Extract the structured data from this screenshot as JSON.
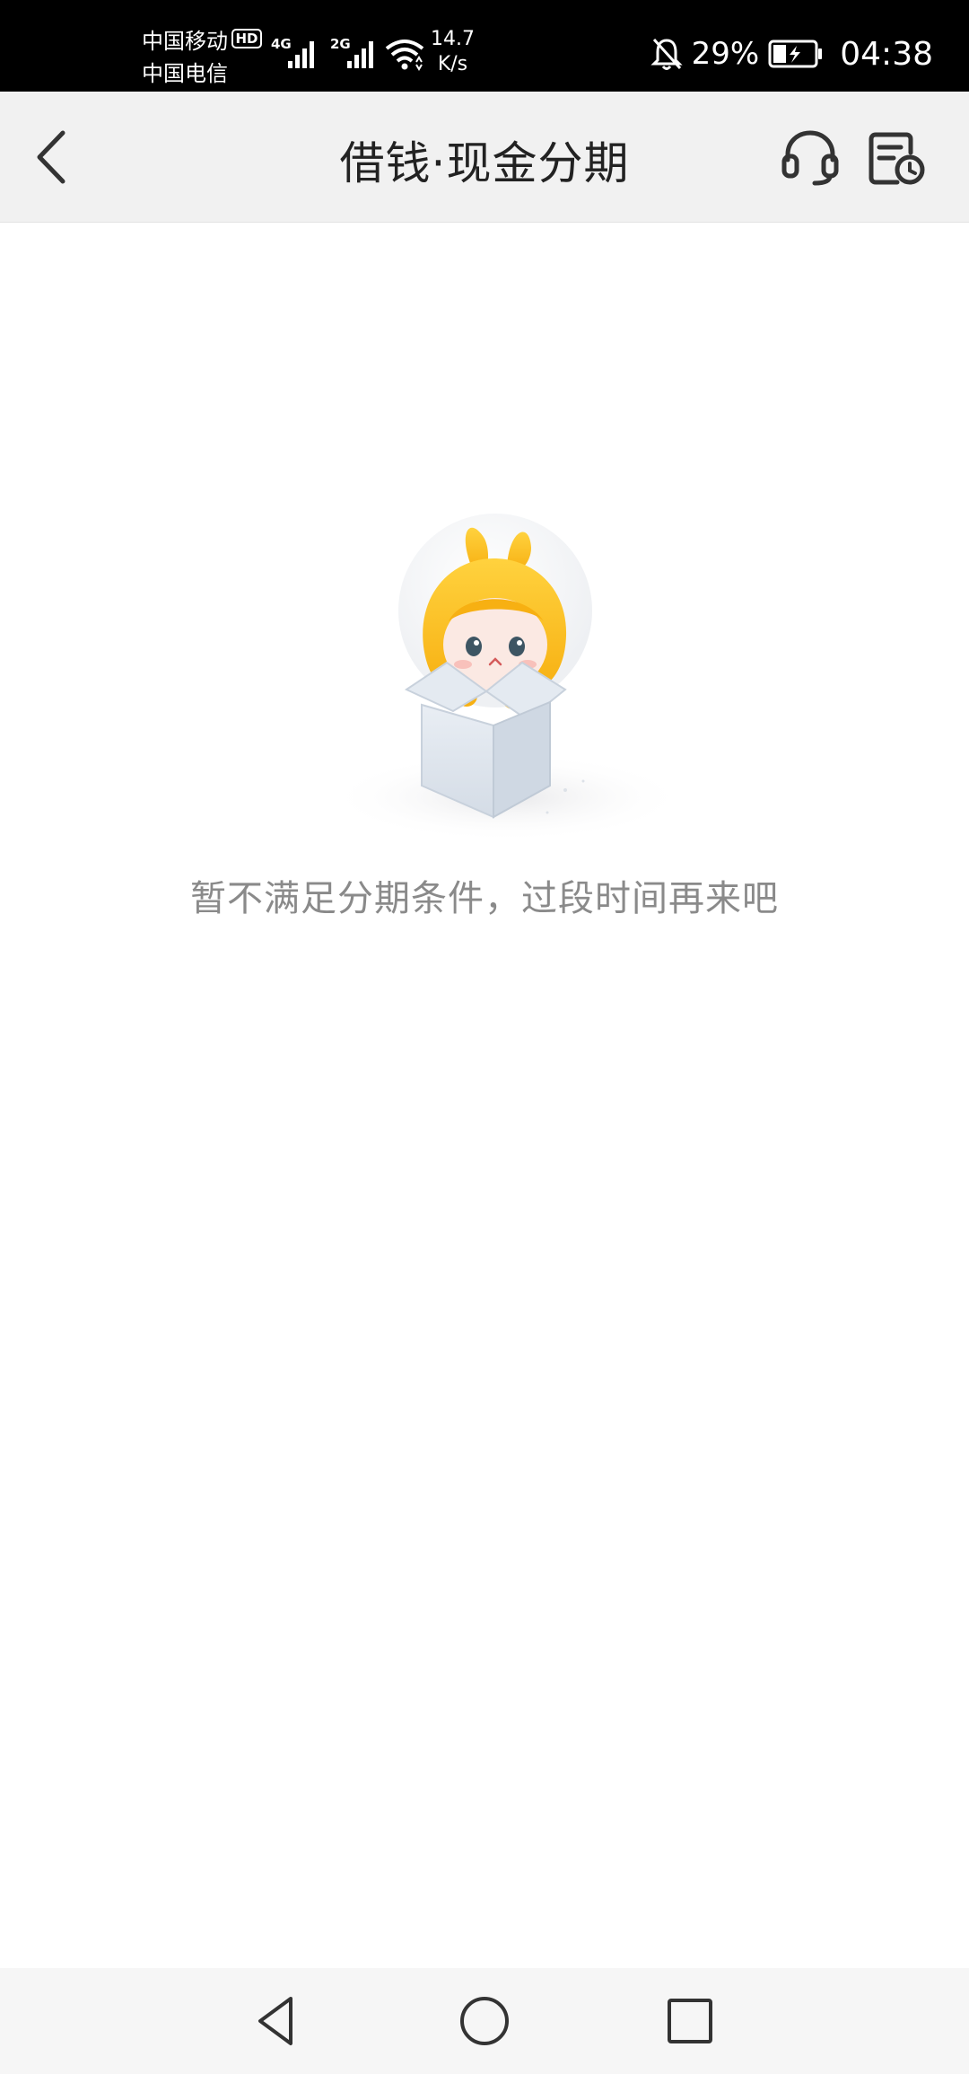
{
  "status_bar": {
    "carrier1": "中国移动",
    "carrier2": "中国电信",
    "hd_badge": "HD",
    "network1": "4G",
    "network2": "2G",
    "speed_value": "14.7",
    "speed_unit": "K/s",
    "battery_percent": "29%",
    "time": "04:38",
    "icons": [
      "signal-icon",
      "wifi-icon",
      "mute-bell-icon",
      "battery-charging-icon"
    ]
  },
  "nav": {
    "title": "借钱·现金分期",
    "icons": [
      "back-arrow-icon",
      "headset-icon",
      "clock-document-icon"
    ]
  },
  "empty_state": {
    "message": "暂不满足分期条件，过段时间再来吧",
    "illustration": "rabbit-in-box-illustration"
  },
  "system_nav": {
    "icons": [
      "triangle-back-icon",
      "circle-home-icon",
      "square-recents-icon"
    ]
  }
}
